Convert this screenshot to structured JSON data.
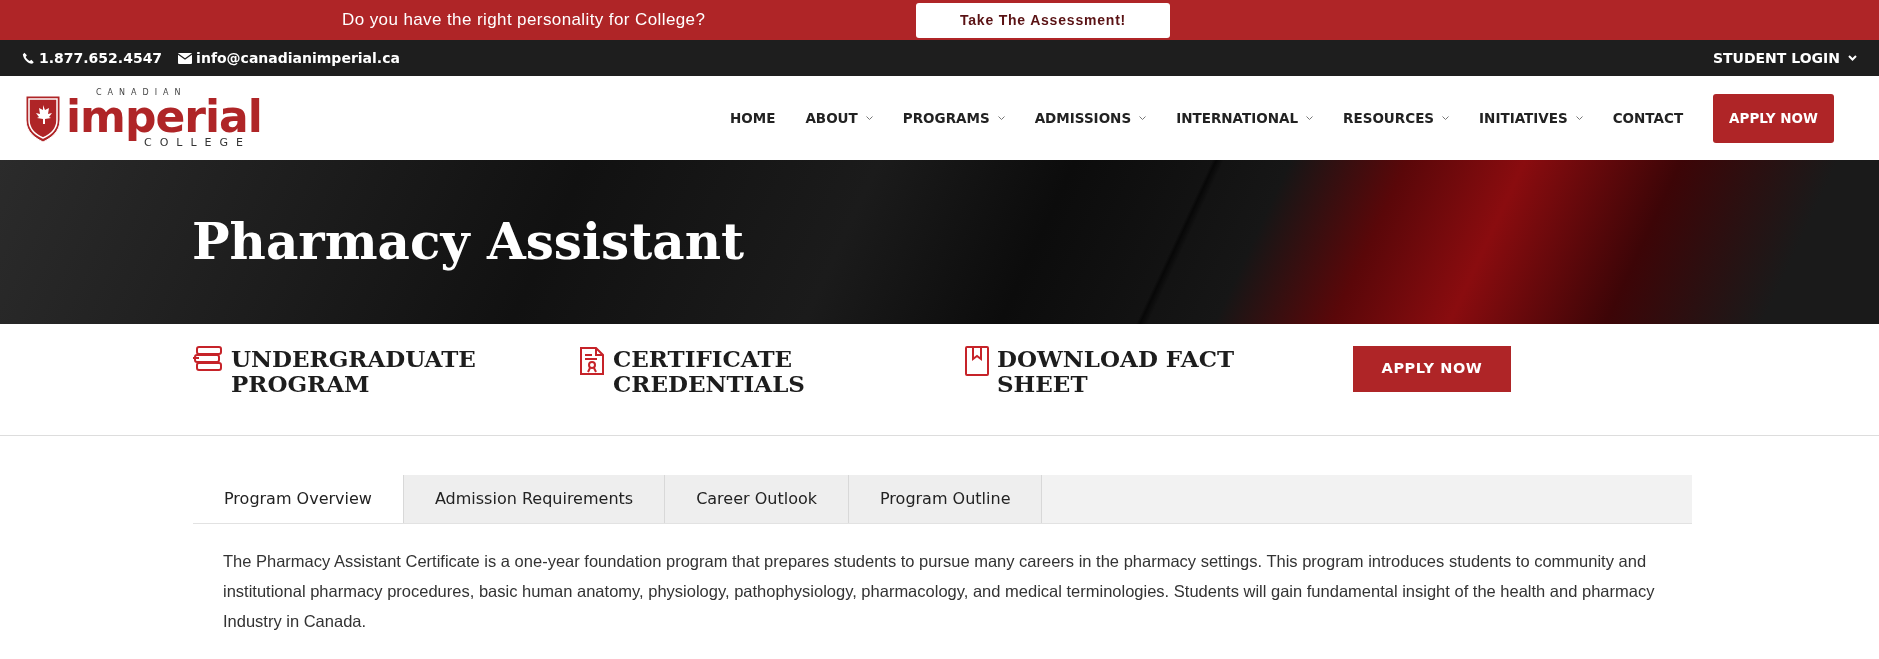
{
  "promo_bar": {
    "text": "Do you have the right personality for College?",
    "button": "Take The Assessment!"
  },
  "contact_bar": {
    "phone": "1.877.652.4547",
    "email": "info@canadianimperial.ca",
    "login": "STUDENT LOGIN"
  },
  "logo": {
    "top": "CANADIAN",
    "main": "imperial",
    "bottom": "COLLEGE"
  },
  "nav": {
    "items": [
      {
        "label": "HOME",
        "has_dropdown": false
      },
      {
        "label": "ABOUT",
        "has_dropdown": true
      },
      {
        "label": "PROGRAMS",
        "has_dropdown": true
      },
      {
        "label": "ADMISSIONS",
        "has_dropdown": true
      },
      {
        "label": "INTERNATIONAL",
        "has_dropdown": true
      },
      {
        "label": "RESOURCES",
        "has_dropdown": true
      },
      {
        "label": "INITIATIVES",
        "has_dropdown": true
      },
      {
        "label": "CONTACT",
        "has_dropdown": false
      }
    ],
    "cta": "APPLY NOW"
  },
  "hero": {
    "title": "Pharmacy Assistant"
  },
  "features": [
    {
      "kind": "books",
      "label": "UNDERGRADUATE PROGRAM"
    },
    {
      "kind": "certificate",
      "label": "CERTIFICATE CREDENTIALS"
    },
    {
      "kind": "bookmark",
      "label": "DOWNLOAD FACT SHEET"
    }
  ],
  "feature_button": "APPLY NOW",
  "tabs": [
    {
      "label": "Program Overview",
      "selected": true
    },
    {
      "label": "Admission Requirements",
      "selected": false
    },
    {
      "label": "Career Outlook",
      "selected": false
    },
    {
      "label": "Program Outline",
      "selected": false
    }
  ],
  "overview": "The Pharmacy Assistant Certificate is a one-year foundation program that prepares students to pursue many careers in the pharmacy settings. This program introduces students to community and institutional pharmacy procedures, basic human anatomy, physiology, pathophysiology, pharmacology, and medical terminologies. Students will gain fundamental insight of the health and pharmacy Industry in Canada."
}
